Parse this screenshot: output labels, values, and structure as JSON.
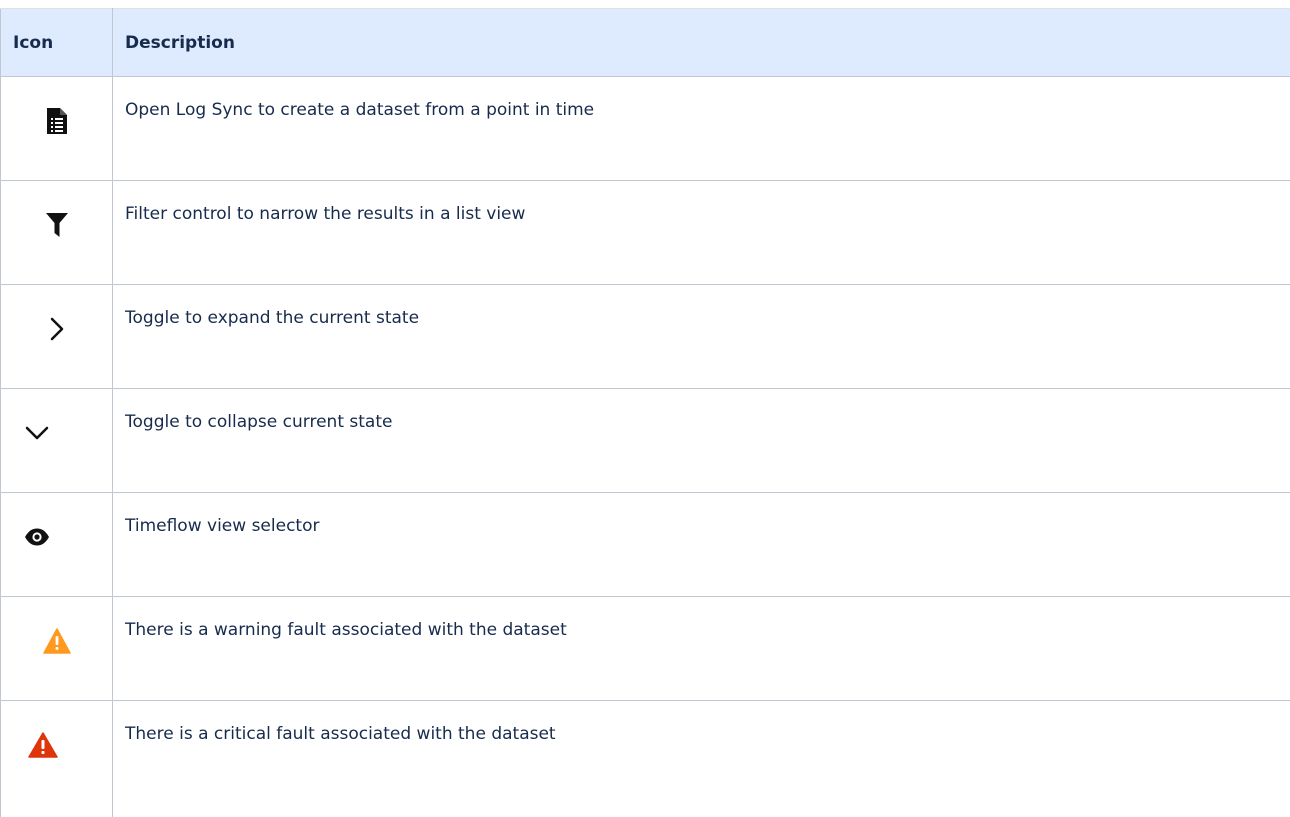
{
  "table": {
    "headers": {
      "icon": "Icon",
      "description": "Description"
    },
    "rows": [
      {
        "icon": "log-file-icon",
        "description": "Open Log Sync to create a dataset from a point in time"
      },
      {
        "icon": "filter-funnel-icon",
        "description": "Filter control to narrow the results in a list view"
      },
      {
        "icon": "chevron-right-icon",
        "description": "Toggle to expand the current state"
      },
      {
        "icon": "chevron-down-icon",
        "description": "Toggle to collapse current state"
      },
      {
        "icon": "eye-icon",
        "description": "Timeflow view selector"
      },
      {
        "icon": "warning-triangle-icon",
        "description": "There is a warning fault associated with the dataset"
      },
      {
        "icon": "critical-triangle-icon",
        "description": "There is a critical fault associated with the dataset"
      }
    ]
  },
  "colors": {
    "header_background": "#deebff",
    "border": "#c1c7d0",
    "text": "#172b4d",
    "icon": "#111111",
    "warning": "#ff991f",
    "critical": "#de350b"
  }
}
